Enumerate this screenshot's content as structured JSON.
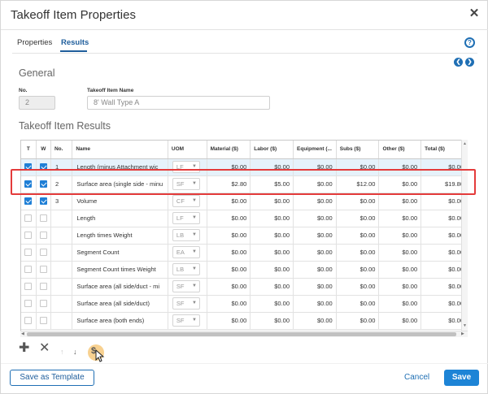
{
  "window": {
    "title": "Takeoff Item Properties"
  },
  "tabs": [
    {
      "label": "Properties",
      "active": false
    },
    {
      "label": "Results",
      "active": true
    }
  ],
  "general": {
    "heading": "General",
    "no_label": "No.",
    "no_value": "2",
    "name_label": "Takeoff Item Name",
    "name_value": "8' Wall Type A"
  },
  "results": {
    "heading": "Takeoff Item Results",
    "columns": [
      "T",
      "W",
      "No.",
      "Name",
      "UOM",
      "Material ($)",
      "Labor ($)",
      "Equipment (...",
      "Subs ($)",
      "Other ($)",
      "Total ($)"
    ],
    "rows": [
      {
        "t": true,
        "w": true,
        "no": "1",
        "name": "Length (minus Attachment wic",
        "uom": "LF",
        "material": "$0.00",
        "labor": "$0.00",
        "equipment": "$0.00",
        "subs": "$0.00",
        "other": "$0.00",
        "total": "$0.00",
        "selected": true
      },
      {
        "t": true,
        "w": true,
        "no": "2",
        "name": "Surface area (single side - minu",
        "uom": "SF",
        "material": "$2.80",
        "labor": "$5.00",
        "equipment": "$0.00",
        "subs": "$12.00",
        "other": "$0.00",
        "total": "$19.80",
        "selected": false
      },
      {
        "t": true,
        "w": true,
        "no": "3",
        "name": "Volume",
        "uom": "CF",
        "material": "$0.00",
        "labor": "$0.00",
        "equipment": "$0.00",
        "subs": "$0.00",
        "other": "$0.00",
        "total": "$0.00",
        "selected": false
      },
      {
        "t": false,
        "w": false,
        "no": "",
        "name": "Length",
        "uom": "LF",
        "material": "$0.00",
        "labor": "$0.00",
        "equipment": "$0.00",
        "subs": "$0.00",
        "other": "$0.00",
        "total": "$0.00",
        "selected": false
      },
      {
        "t": false,
        "w": false,
        "no": "",
        "name": "Length times Weight",
        "uom": "LB",
        "material": "$0.00",
        "labor": "$0.00",
        "equipment": "$0.00",
        "subs": "$0.00",
        "other": "$0.00",
        "total": "$0.00",
        "selected": false
      },
      {
        "t": false,
        "w": false,
        "no": "",
        "name": "Segment Count",
        "uom": "EA",
        "material": "$0.00",
        "labor": "$0.00",
        "equipment": "$0.00",
        "subs": "$0.00",
        "other": "$0.00",
        "total": "$0.00",
        "selected": false
      },
      {
        "t": false,
        "w": false,
        "no": "",
        "name": "Segment Count times Weight",
        "uom": "LB",
        "material": "$0.00",
        "labor": "$0.00",
        "equipment": "$0.00",
        "subs": "$0.00",
        "other": "$0.00",
        "total": "$0.00",
        "selected": false
      },
      {
        "t": false,
        "w": false,
        "no": "",
        "name": "Surface area (all side/duct - mi",
        "uom": "SF",
        "material": "$0.00",
        "labor": "$0.00",
        "equipment": "$0.00",
        "subs": "$0.00",
        "other": "$0.00",
        "total": "$0.00",
        "selected": false
      },
      {
        "t": false,
        "w": false,
        "no": "",
        "name": "Surface area (all side/duct)",
        "uom": "SF",
        "material": "$0.00",
        "labor": "$0.00",
        "equipment": "$0.00",
        "subs": "$0.00",
        "other": "$0.00",
        "total": "$0.00",
        "selected": false
      },
      {
        "t": false,
        "w": false,
        "no": "",
        "name": "Surface area (both ends)",
        "uom": "SF",
        "material": "$0.00",
        "labor": "$0.00",
        "equipment": "$0.00",
        "subs": "$0.00",
        "other": "$0.00",
        "total": "$0.00",
        "selected": false
      }
    ]
  },
  "toolbar": {
    "add_icon": "plus-icon",
    "delete_icon": "x-icon",
    "move_up_icon": "arrow-up-icon",
    "move_down_icon": "arrow-down-icon",
    "cost_icon": "dollar-icon"
  },
  "footer": {
    "save_template_label": "Save as Template",
    "cancel_label": "Cancel",
    "save_label": "Save"
  },
  "colors": {
    "accent": "#1d84d6",
    "highlight": "#e43b3b",
    "selected_row": "#e6f2fb"
  }
}
